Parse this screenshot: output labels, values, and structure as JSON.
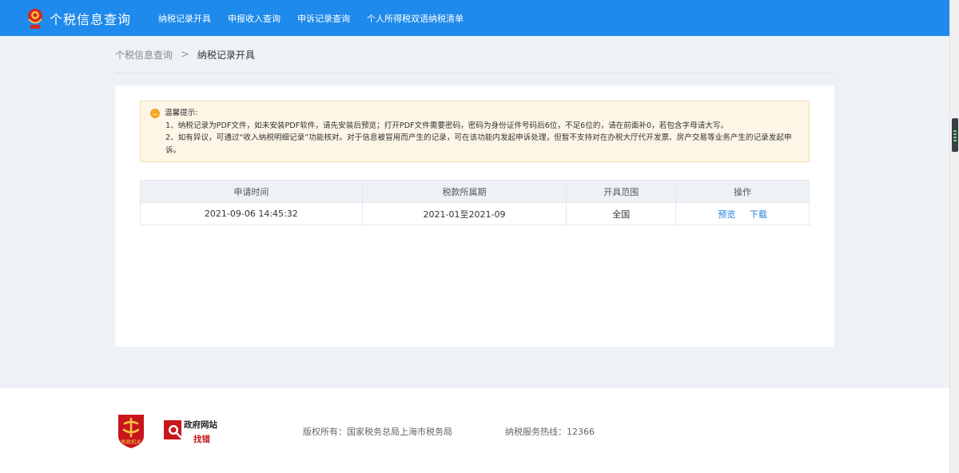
{
  "header": {
    "brand": "个税信息查询",
    "nav": [
      "纳税记录开具",
      "申报收入查询",
      "申诉记录查询",
      "个人所得税双语纳税清单"
    ]
  },
  "breadcrumb": {
    "root": "个税信息查询",
    "separator": ">",
    "current": "纳税记录开具"
  },
  "tip": {
    "title": "温馨提示:",
    "line1": "1、纳税记录为PDF文件，如未安装PDF软件，请先安装后预览；打开PDF文件需要密码，密码为身份证件号码后6位，不足6位的，请在前面补0，若包含字母请大写。",
    "line2": "2、如有异议，可通过“收入纳税明细记录”功能核对。对于信息被冒用而产生的记录，可在该功能内发起申诉处理，但暂不支持对在办税大厅代开发票、房产交易等业务产生的记录发起申诉。"
  },
  "table": {
    "headers": [
      "申请时间",
      "税款所属期",
      "开具范围",
      "操作"
    ],
    "rows": [
      {
        "time": "2021-09-06 14:45:32",
        "period": "2021-01至2021-09",
        "scope": "全国",
        "actions": [
          "预览",
          "下载"
        ]
      }
    ]
  },
  "footer": {
    "party_logo_text": "党政机关",
    "gov_title": "政府网站",
    "gov_sub": "找错",
    "copyright": "版权所有：国家税务总局上海市税务局",
    "hotline": "纳税服务热线：12366"
  },
  "colors": {
    "primary": "#1e8aeb",
    "link": "#1e7de0",
    "tip_bg": "#fdf6e6",
    "tip_border": "#f3dcb0",
    "party_red": "#c8161d"
  },
  "icons": {
    "emblem": "tax-emblem-icon",
    "breadcrumb_sep": "chevron-right-icon",
    "tip": "smile-icon",
    "scroll": "scrollbar-thumb"
  }
}
